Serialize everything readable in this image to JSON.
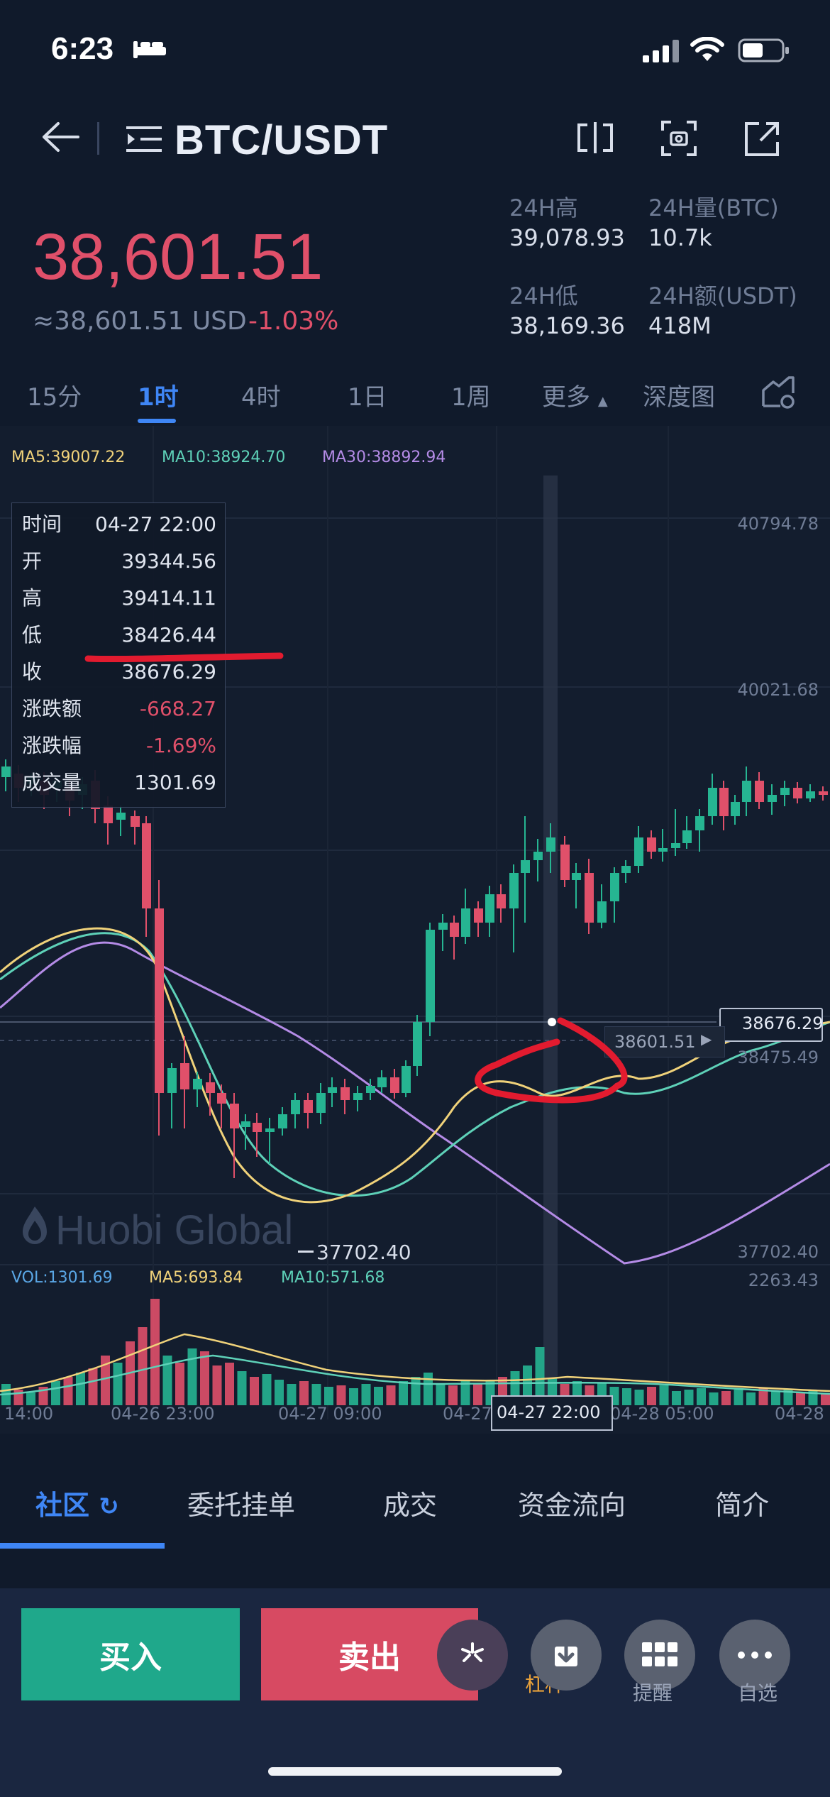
{
  "status_bar": {
    "time": "6:23"
  },
  "header": {
    "pair": "BTC/USDT"
  },
  "price": {
    "last": "38,601.51",
    "usd": "≈38,601.51 USD",
    "change_pct": "-1.03%"
  },
  "stats": {
    "high_label": "24H高",
    "high_value": "39,078.93",
    "vol_label": "24H量(BTC)",
    "vol_value": "10.7k",
    "low_label": "24H低",
    "low_value": "38,169.36",
    "amount_label": "24H额(USDT)",
    "amount_value": "418M"
  },
  "period_tabs": {
    "t15m": "15分",
    "t1h": "1时",
    "t4h": "4时",
    "t1d": "1日",
    "t1w": "1周",
    "more": "更多",
    "depth": "深度图"
  },
  "chart": {
    "ma5": "MA5:39007.22",
    "ma10": "MA10:38924.70",
    "ma30": "MA30:38892.94",
    "price_ticks": [
      "40794.78",
      "40021.68",
      "38475.49",
      "37702.40"
    ],
    "crosshair_price": "38676.29",
    "last_price_tag": "38601.51",
    "min_label": "37702.40",
    "watermark": "Huobi Global",
    "vol": "VOL:1301.69",
    "vol_ma5": "MA5:693.84",
    "vol_ma10": "MA10:571.68",
    "vol_max": "2263.43",
    "time_labels": [
      "14:00",
      "04-26 23:00",
      "04-27 09:00",
      "04-27",
      "04-28 05:00",
      "04-28"
    ],
    "crosshair_time": "04-27 22:00",
    "colors": {
      "up": "#26b592",
      "down": "#e0506a",
      "ma5": "#f0d27a",
      "ma10": "#5ed1b8",
      "ma30": "#b48be6"
    }
  },
  "info_box": {
    "rows": [
      {
        "k": "时间",
        "v": "04-27 22:00"
      },
      {
        "k": "开",
        "v": "39344.56"
      },
      {
        "k": "高",
        "v": "39414.11"
      },
      {
        "k": "低",
        "v": "38426.44"
      },
      {
        "k": "收",
        "v": "38676.29"
      },
      {
        "k": "涨跌额",
        "v": "-668.27"
      },
      {
        "k": "涨跌幅",
        "v": "-1.69%"
      },
      {
        "k": "成交量",
        "v": "1301.69"
      }
    ]
  },
  "bottom_tabs": {
    "community": "社区",
    "orders": "委托挂单",
    "trades": "成交",
    "capital_flow": "资金流向",
    "intro": "简介"
  },
  "actions": {
    "buy": "买入",
    "sell": "卖出",
    "leverage": "杠杆",
    "alert": "提醒",
    "favorite": "自选"
  }
}
